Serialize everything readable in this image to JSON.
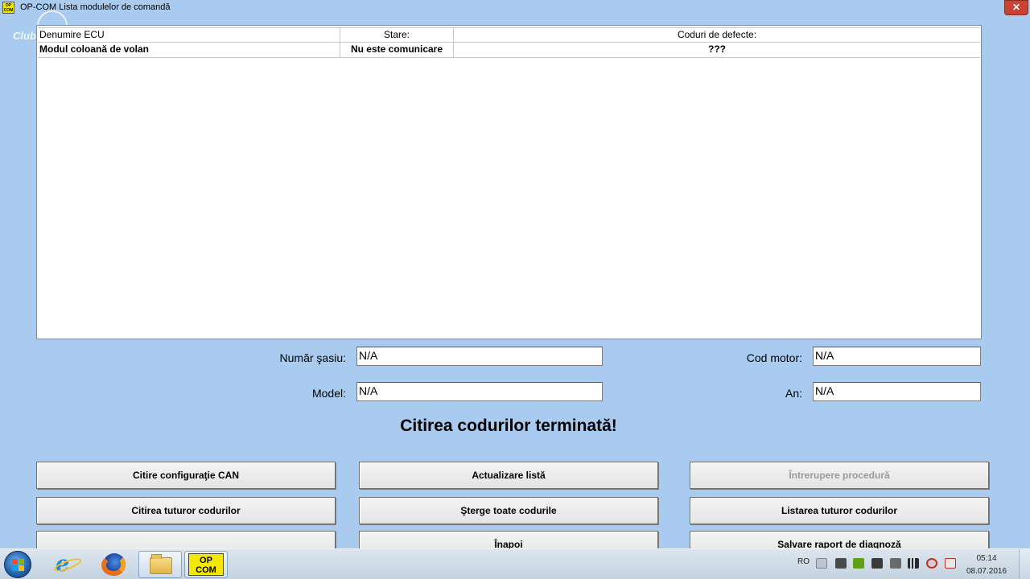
{
  "window": {
    "title": "OP-COM  Lista modulelor de comandă",
    "icon_text": "OP COM",
    "watermark": "Club",
    "close_label": "✕"
  },
  "table": {
    "columns": [
      "Denumire ECU",
      "Stare:",
      "Coduri de defecte:"
    ],
    "rows": [
      [
        "Modul coloană de volan",
        "Nu este comunicare",
        "???"
      ]
    ]
  },
  "vehicle": {
    "chassis_label": "Număr şasiu:",
    "chassis_value": "N/A",
    "engine_label": "Cod motor:",
    "engine_value": "N/A",
    "model_label": "Model:",
    "model_value": "N/A",
    "year_label": "An:",
    "year_value": "N/A"
  },
  "status_message": "Citirea codurilor terminată!",
  "buttons": {
    "read_can_config": "Citire configuraţie CAN",
    "refresh_list": "Actualizare listă",
    "abort_procedure": "Întrerupere procedură",
    "read_all_codes": "Citirea tuturor codurilor",
    "clear_all_codes": "Şterge toate codurile",
    "list_all_codes": "Listarea tuturor codurilor",
    "empty_button": "",
    "back": "Înapoi",
    "save_report": "Salvare raport de diagnoză"
  },
  "taskbar": {
    "op_com_label": "OP COM",
    "language": "RO",
    "time": "05:14",
    "date": "08.07.2016",
    "icons": [
      "start-orb-icon",
      "internet-explorer-icon",
      "firefox-icon",
      "file-explorer-icon",
      "op-com-icon"
    ]
  }
}
